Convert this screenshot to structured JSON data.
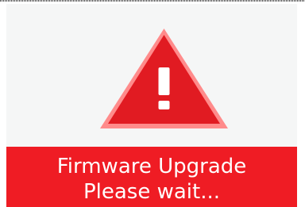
{
  "screen": {
    "icon": "warning-icon",
    "colors": {
      "panel_background": "#f5f6f6",
      "banner_background": "#ef1c24",
      "banner_text": "#ffffff",
      "warning_fill": "#e11b22",
      "warning_outline": "#ff8b8b",
      "warning_mark": "#ffffff"
    },
    "message_line_1": "Firmware Upgrade",
    "message_line_2": "Please wait..."
  }
}
